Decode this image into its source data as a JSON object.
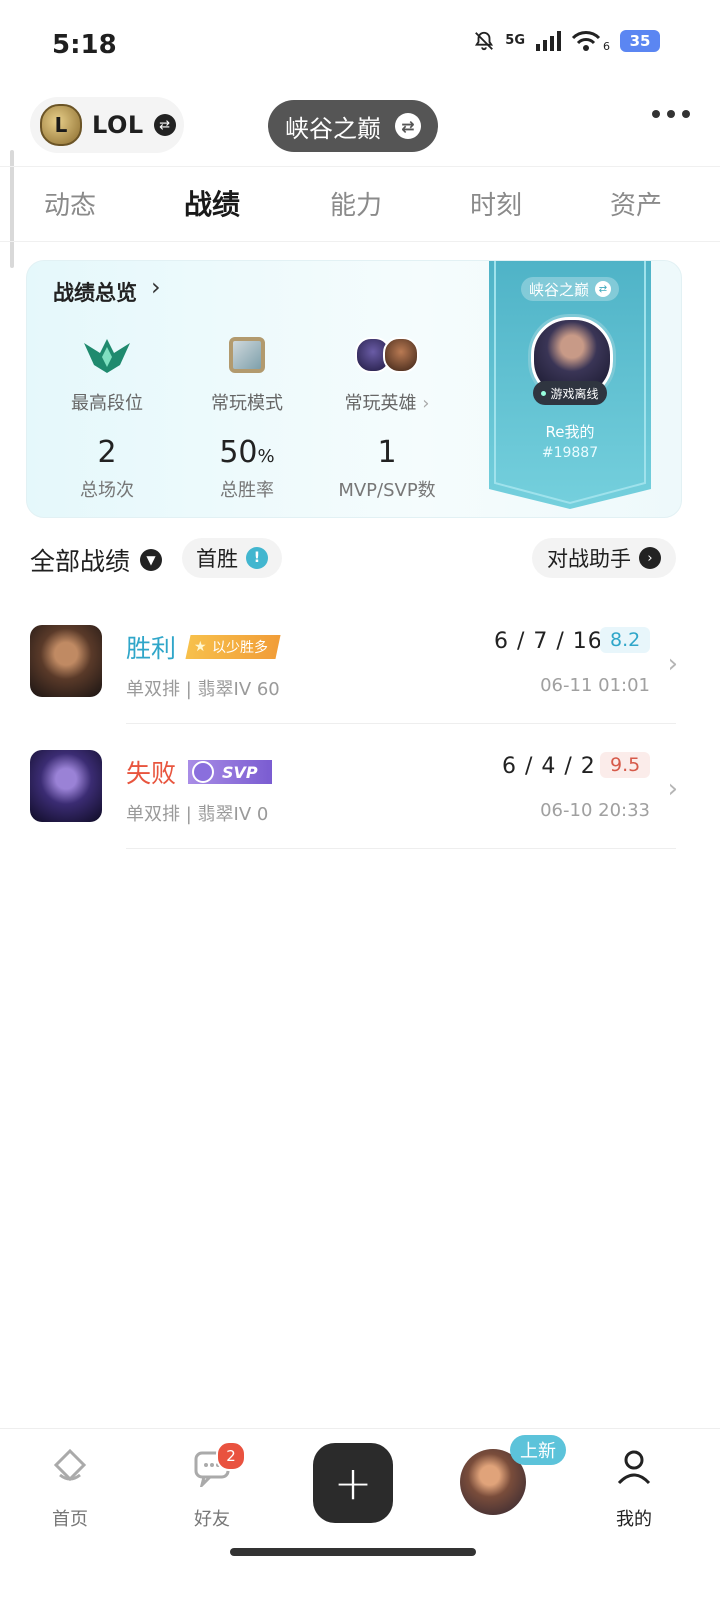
{
  "status_bar": {
    "time": "5:18",
    "network": "5G",
    "wifi_sub": "6",
    "battery": "35"
  },
  "header": {
    "game": "LOL",
    "region": "峡谷之巅"
  },
  "tabs": [
    "动态",
    "战绩",
    "能力",
    "时刻",
    "资产"
  ],
  "active_tab": "战绩",
  "overview": {
    "title": "战绩总览",
    "columns": [
      {
        "label": "最高段位",
        "value": "2",
        "unit": "",
        "sub": "总场次"
      },
      {
        "label": "常玩模式",
        "value": "50",
        "unit": "%",
        "sub": "总胜率"
      },
      {
        "label": "常玩英雄",
        "value": "1",
        "unit": "",
        "sub": "MVP/SVP数"
      }
    ],
    "ribbon": {
      "region": "峡谷之巅",
      "status": "游戏离线",
      "name": "Re我的",
      "tag": "#19887"
    }
  },
  "filters": {
    "all": "全部战绩",
    "first_win": "首胜",
    "assistant": "对战助手"
  },
  "matches": [
    {
      "result": "胜利",
      "badge": "以少胜多",
      "kda": "6 / 7 / 16",
      "score": "8.2",
      "meta": "单双排 | 翡翠IV 60",
      "date": "06-11 01:01"
    },
    {
      "result": "失败",
      "badge": "SVP",
      "kda": "6 / 4 / 2",
      "score": "9.5",
      "meta": "单双排 | 翡翠IV 0",
      "date": "06-10 20:33"
    }
  ],
  "bottom_nav": {
    "home": "首页",
    "friends": "好友",
    "friends_badge": "2",
    "new_badge": "上新",
    "mine": "我的"
  },
  "colors": {
    "win": "#2fa6c9",
    "loss": "#e8553e",
    "accent": "#5cc3da"
  }
}
